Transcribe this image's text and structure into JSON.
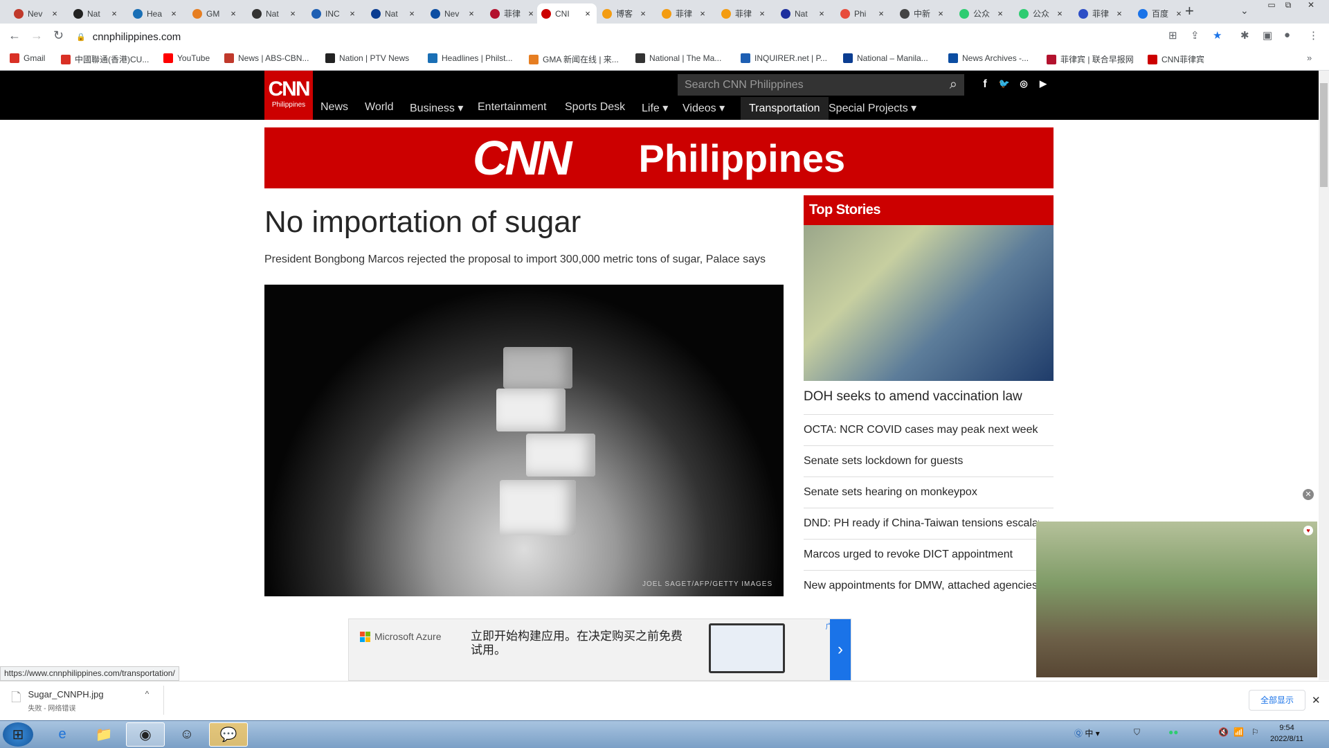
{
  "browser": {
    "tabs": [
      {
        "label": "Nev",
        "color": "#c0392b"
      },
      {
        "label": "Nat",
        "color": "#222"
      },
      {
        "label": "Hea",
        "color": "#1a6fb5"
      },
      {
        "label": "GM",
        "color": "#e67e22"
      },
      {
        "label": "Nat",
        "color": "#333"
      },
      {
        "label": "INC",
        "color": "#1e5fb3"
      },
      {
        "label": "Nat",
        "color": "#0b3d91"
      },
      {
        "label": "Nev",
        "color": "#0b4da2"
      },
      {
        "label": "菲律",
        "color": "#b3122e"
      },
      {
        "label": "CNI",
        "color": "#cc0000"
      },
      {
        "label": "博客",
        "color": "#f39c12"
      },
      {
        "label": "菲律",
        "color": "#f39c12"
      },
      {
        "label": "菲律",
        "color": "#f39c12"
      },
      {
        "label": "Nat",
        "color": "#1d2f9e"
      },
      {
        "label": "Phi",
        "color": "#e74c3c"
      },
      {
        "label": "中新",
        "color": "#444"
      },
      {
        "label": "公众",
        "color": "#2ecc71"
      },
      {
        "label": "公众",
        "color": "#2ecc71"
      },
      {
        "label": "菲律",
        "color": "#2d4ec6"
      },
      {
        "label": "百度",
        "color": "#1a73e8"
      }
    ],
    "active_tab_index": 9,
    "url": "cnnphilippines.com",
    "bookmarks": [
      {
        "label": "Gmail",
        "color": "#d93025"
      },
      {
        "label": "中國聯通(香港)CU...",
        "color": "#d93025"
      },
      {
        "label": "YouTube",
        "color": "#ff0000"
      },
      {
        "label": "News | ABS-CBN...",
        "color": "#c0392b"
      },
      {
        "label": "Nation | PTV News",
        "color": "#222"
      },
      {
        "label": "Headlines | Philst...",
        "color": "#1a6fb5"
      },
      {
        "label": "GMA 新闻在线 | 来...",
        "color": "#e67e22"
      },
      {
        "label": "National | The Ma...",
        "color": "#333"
      },
      {
        "label": "INQUIRER.net | P...",
        "color": "#1e5fb3"
      },
      {
        "label": "National – Manila...",
        "color": "#0b3d91"
      },
      {
        "label": "News Archives -...",
        "color": "#0b4da2"
      },
      {
        "label": "菲律宾 | 联合早报网",
        "color": "#b3122e"
      },
      {
        "label": "CNN菲律宾",
        "color": "#cc0000"
      }
    ]
  },
  "site": {
    "logo_top": "CNN",
    "logo_bottom": "Philippines",
    "search_placeholder": "Search CNN Philippines",
    "social": [
      "f",
      "t",
      "ig",
      "yt"
    ],
    "nav": [
      {
        "label": "News"
      },
      {
        "label": "World"
      },
      {
        "label": "Business ▾"
      },
      {
        "label": "Entertainment"
      },
      {
        "label": "Sports Desk"
      },
      {
        "label": "Life ▾"
      },
      {
        "label": "Videos ▾"
      },
      {
        "label": "Transportation"
      },
      {
        "label": "Special Projects ▾"
      }
    ],
    "banner_left": "CNN",
    "banner_right": "Philippines"
  },
  "article": {
    "headline": "No importation of sugar",
    "subhead": "President Bongbong Marcos rejected the proposal to import 300,000 metric tons of sugar, Palace says",
    "image_credit": "JOEL SAGET/AFP/GETTY IMAGES"
  },
  "top_stories": {
    "title": "Top Stories",
    "lead": "DOH seeks to amend vaccination law",
    "items": [
      "OCTA: NCR COVID cases may peak next week",
      "Senate sets lockdown for guests",
      "Senate sets hearing on monkeypox",
      "DND: PH ready if China-Taiwan tensions escalate",
      "Marcos urged to revoke DICT appointment",
      "New appointments for DMW, attached agencies"
    ]
  },
  "ad": {
    "brand": "Microsoft Azure",
    "text": "立即开始构建应用。在决定购买之前免费试用。",
    "ad_tag": "广告"
  },
  "status_url": "https://www.cnnphilippines.com/transportation/",
  "download": {
    "filename": "Sugar_CNNPH.jpg",
    "status": "失败 - 网络错误",
    "show_all": "全部显示"
  },
  "taskbar": {
    "time": "9:54",
    "date": "2022/8/11",
    "ime": "中"
  }
}
